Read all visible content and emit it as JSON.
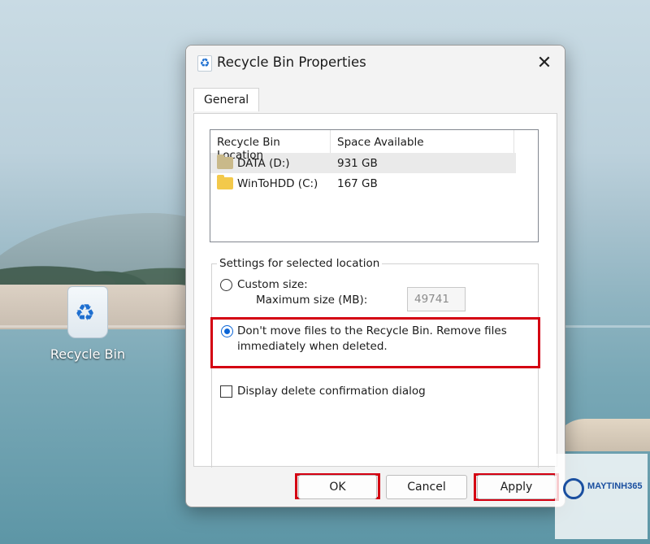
{
  "desktop": {
    "recycle_bin_label": "Recycle Bin"
  },
  "dialog": {
    "title": "Recycle Bin Properties",
    "close_glyph": "✕",
    "tab_label": "General",
    "listview": {
      "columns": [
        "Recycle Bin Location",
        "Space Available"
      ],
      "rows": [
        {
          "location": "DATA (D:)",
          "space": "931 GB",
          "selected": true
        },
        {
          "location": "WinToHDD (C:)",
          "space": "167 GB",
          "selected": false
        }
      ]
    },
    "settings": {
      "legend": "Settings for selected location",
      "custom_size_label": "Custom size:",
      "max_size_label": "Maximum size (MB):",
      "max_size_value": "49741",
      "dont_move_label_line1": "Don't move files to the Recycle Bin. Remove files",
      "dont_move_label_line2": "immediately when deleted.",
      "display_confirm_label": "Display delete confirmation dialog",
      "custom_size_checked": false,
      "dont_move_checked": true,
      "display_confirm_checked": false
    },
    "buttons": {
      "ok": "OK",
      "cancel": "Cancel",
      "apply": "Apply"
    }
  },
  "watermark": {
    "brand": "MAYTINH365"
  },
  "colors": {
    "highlight": "#d40012",
    "accent": "#0a64d6",
    "folder_data": "#c9b98a",
    "folder_c": "#f3c94b"
  },
  "icons": {
    "recycle_bin": "recycle-bin-icon",
    "folder": "folder-icon",
    "close": "close-icon"
  }
}
